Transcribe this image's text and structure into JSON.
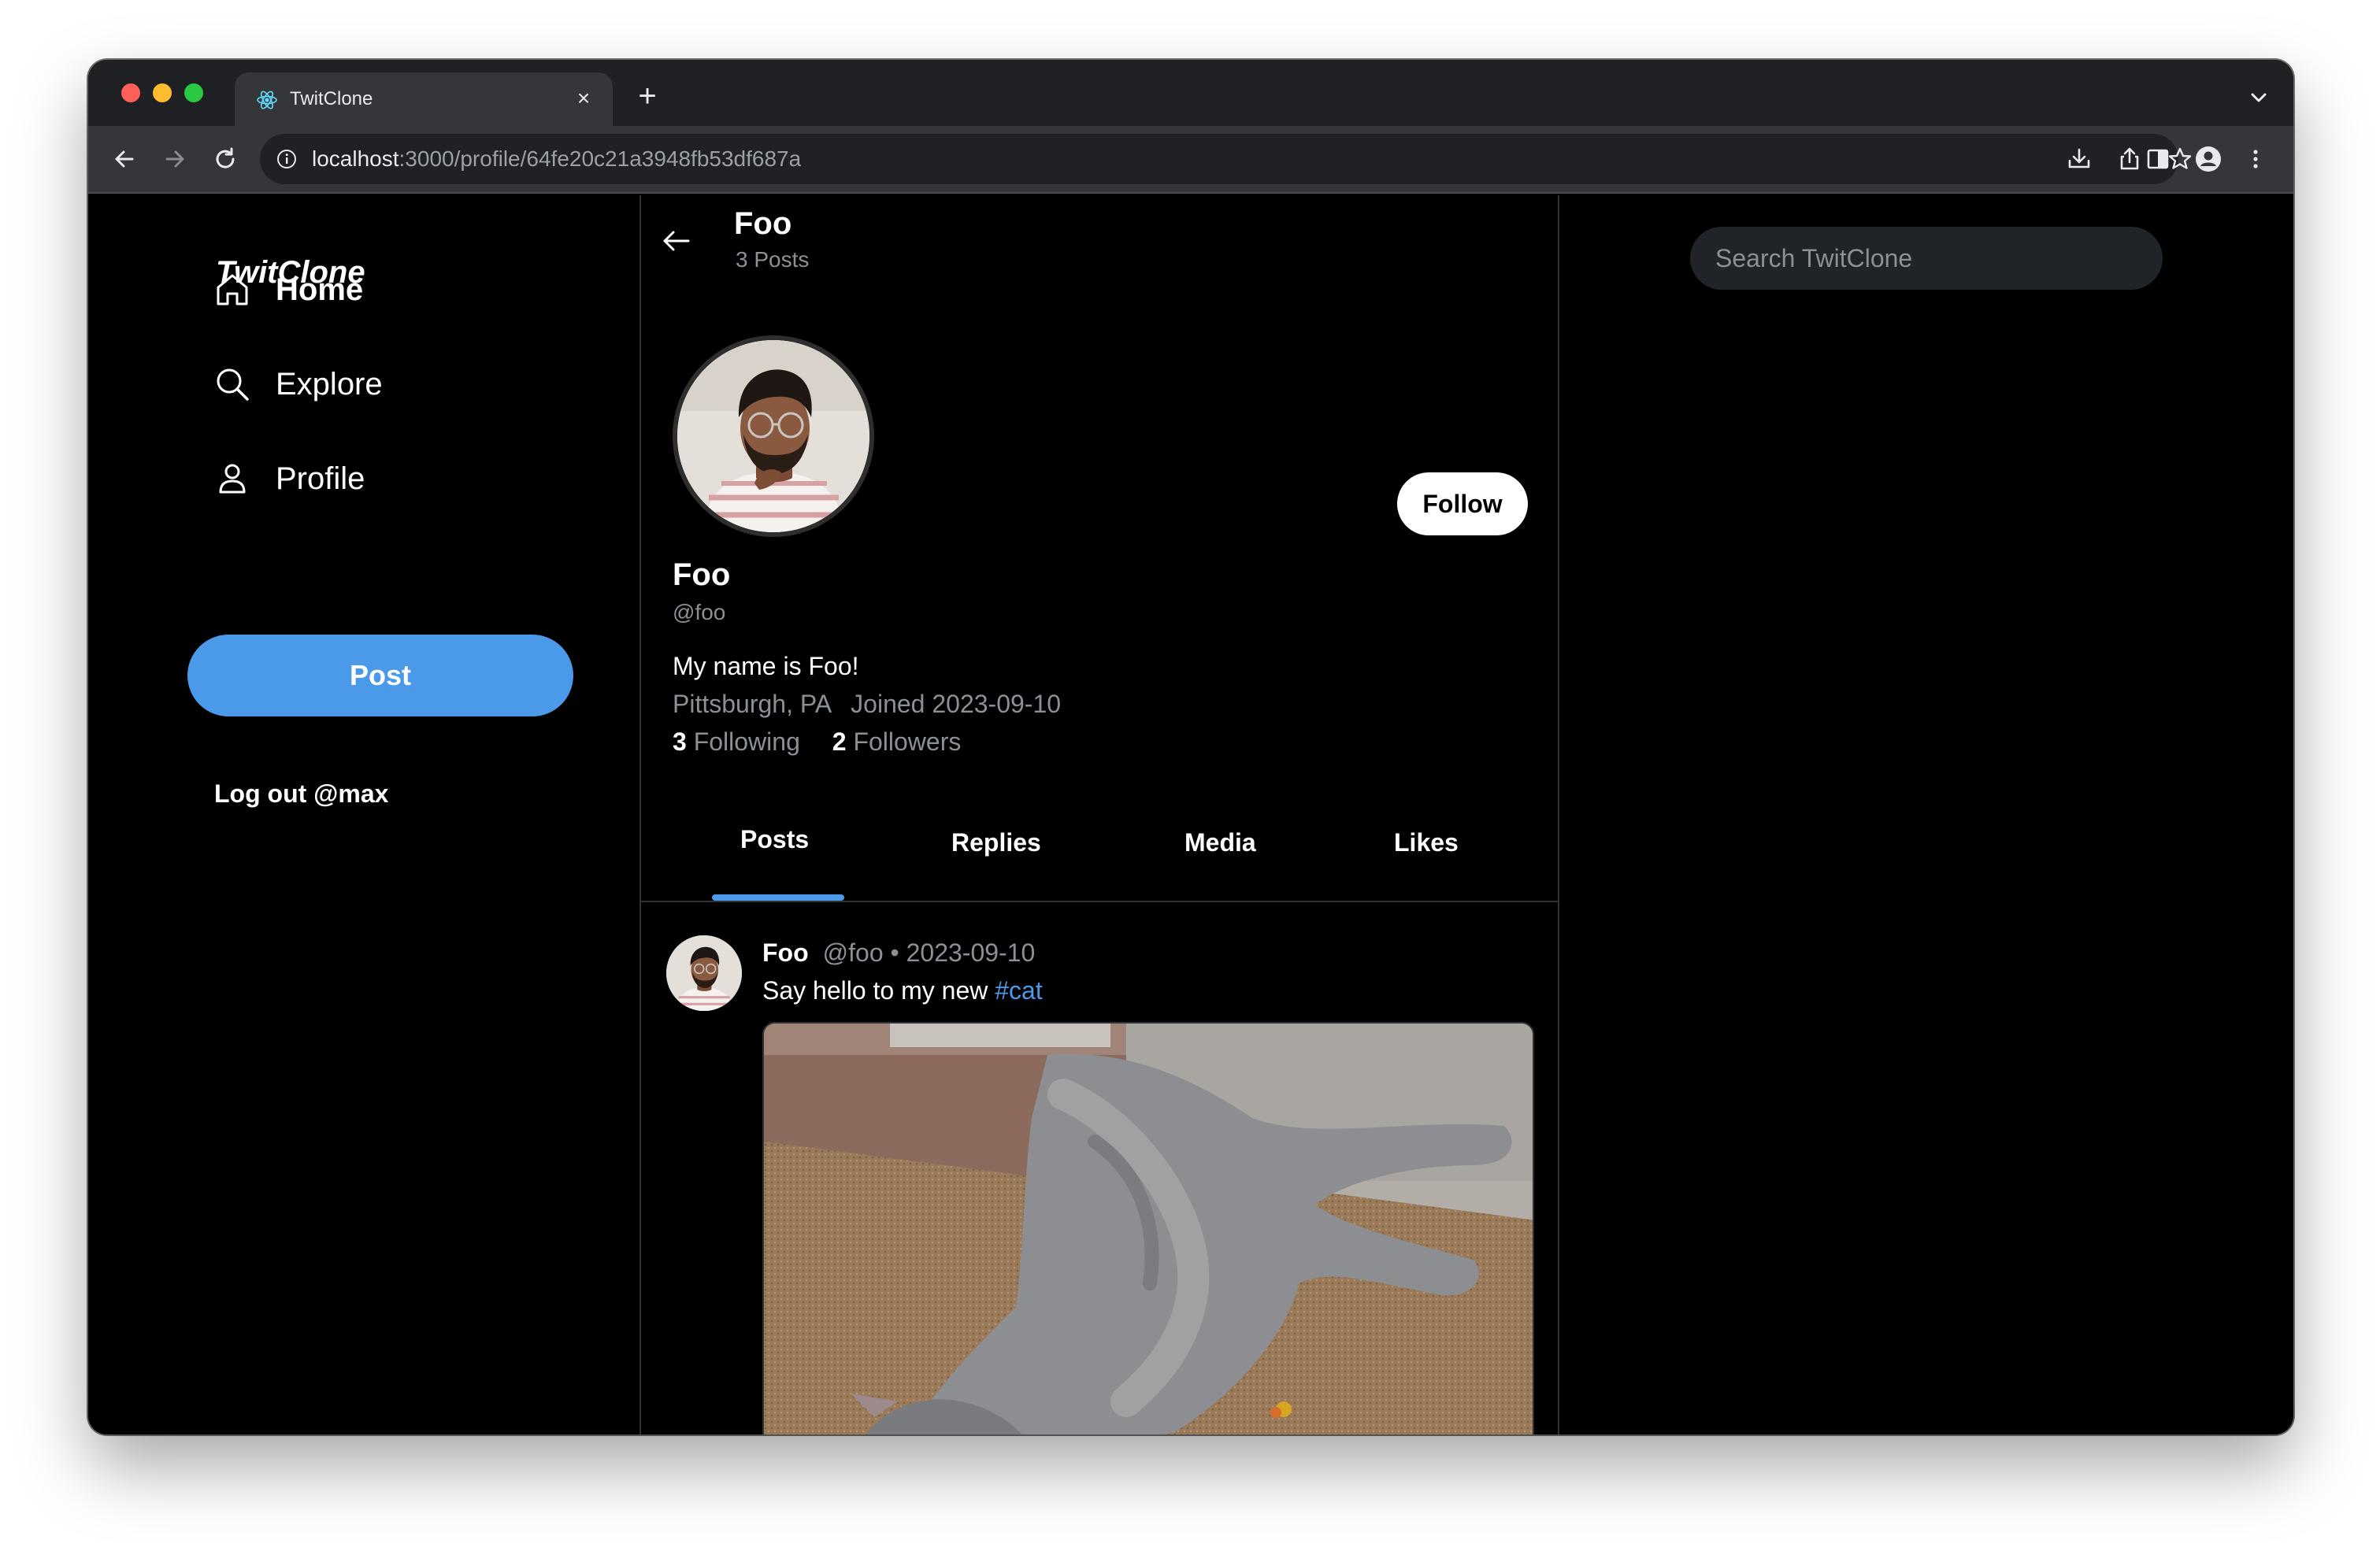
{
  "browser": {
    "tab_title": "TwitClone",
    "close_glyph": "×",
    "newtab_glyph": "+",
    "url_host": "localhost",
    "url_path": ":3000/profile/64fe20c21a3948fb53df687a"
  },
  "sidebar": {
    "brand": "TwitClone",
    "nav": [
      {
        "label": "Home",
        "icon": "home-icon"
      },
      {
        "label": "Explore",
        "icon": "search-icon"
      },
      {
        "label": "Profile",
        "icon": "user-icon"
      }
    ],
    "post_label": "Post",
    "logout_label": "Log out @max"
  },
  "header": {
    "name": "Foo",
    "post_count": "3 Posts"
  },
  "profile": {
    "name": "Foo",
    "handle": "@foo",
    "bio": "My name is Foo!",
    "location": "Pittsburgh, PA",
    "joined": "Joined 2023-09-10",
    "following_count": "3",
    "following_label": "Following",
    "followers_count": "2",
    "followers_label": "Followers",
    "follow_label": "Follow"
  },
  "tabs": [
    {
      "label": "Posts",
      "active": true
    },
    {
      "label": "Replies",
      "active": false
    },
    {
      "label": "Media",
      "active": false
    },
    {
      "label": "Likes",
      "active": false
    }
  ],
  "posts": [
    {
      "author": "Foo",
      "meta": "@foo • 2023-09-10",
      "text": "Say hello to my new ",
      "hashtag": "#cat"
    }
  ],
  "search": {
    "placeholder": "Search TwitClone"
  },
  "colors": {
    "accent": "#4a9ae9",
    "background": "#000000",
    "muted_text": "#8b9096",
    "border": "#2f3336"
  }
}
